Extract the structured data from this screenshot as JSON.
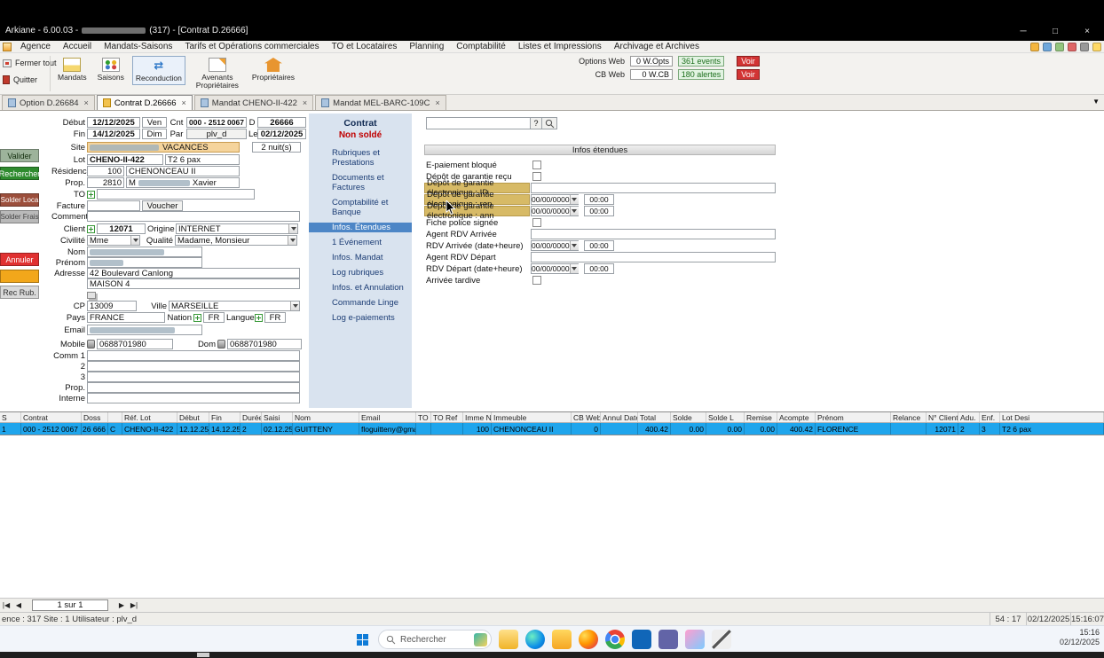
{
  "icons": {
    "minimize": "─",
    "maximize": "□",
    "close": "×",
    "tab_close": "×",
    "chevron_down": "▼",
    "first": "|◀",
    "prev": "◀",
    "next": "▶",
    "last": "▶|",
    "help": "?",
    "swap": "⇄"
  },
  "colors": {
    "selected_row": "#1fa5ec",
    "nav_selected": "#4d86c6",
    "highlight_gold": "#d7ba66",
    "site_highlight": "#f5d49c",
    "annuler_red": "#e03131",
    "rechercher_green": "#2e8b2e",
    "voir_red": "#d23434"
  },
  "window": {
    "title_prefix": "Arkiane - 6.00.03 -",
    "title_suffix": "(317) - [Contrat D.26666]"
  },
  "menu": {
    "items": [
      "Agence",
      "Accueil",
      "Mandats-Saisons",
      "Tarifs et Opérations commerciales",
      "TO et Locataires",
      "Planning",
      "Comptabilité",
      "Listes et Impressions",
      "Archivage et Archives"
    ]
  },
  "toolbar": {
    "fermer_tout": "Fermer tout",
    "quitter": "Quitter",
    "mandats": "Mandats",
    "saisons": "Saisons",
    "reconduction": "Reconduction",
    "avenants": "Avenants Propriétaires",
    "proprietaires": "Propriétaires",
    "options_web_label": "Options Web",
    "options_web_value": "0 W.Opts",
    "events_value": "361 events",
    "cb_web_label": "CB Web",
    "cb_web_value": "0 W.CB",
    "alertes_value": "180 alertes",
    "voir": "Voir"
  },
  "tabs": [
    "Option D.26684",
    "Contrat D.26666",
    "Mandat CHENO-II-422",
    "Mandat MEL-BARC-109C"
  ],
  "actions": {
    "valider": "Valider",
    "rechercher": "Rechercher",
    "solder_loca": "Solder Loca",
    "solder_frais": "Solder Frais",
    "annuler": "Annuler",
    "rec_rub": "Rec Rub."
  },
  "form": {
    "debut_label": "Début",
    "debut": "12/12/2025",
    "debut_day": "Ven",
    "cnt_label": "Cnt",
    "cnt": "000 - 2512 0067",
    "d_label": "D",
    "dossier": "26666",
    "fin_label": "Fin",
    "fin": "14/12/2025",
    "fin_day": "Dim",
    "par_label": "Par",
    "par": "plv_d",
    "le_label": "Le",
    "saisi_le": "02/12/2025",
    "site_label": "Site",
    "site": "VACANCES",
    "nuits": "2 nuit(s)",
    "lot_label": "Lot",
    "lot": "CHENO-II-422",
    "lot_type": "T2 6 pax",
    "residence_label": "Résidence",
    "residence_num": "100",
    "residence_name": "CHENONCEAU II",
    "prop_label": "Prop.",
    "prop_num": "2810",
    "prop_prefix": "M",
    "prop_suffix": "Xavier",
    "to_label": "TO",
    "facture_label": "Facture",
    "voucher_label": "Voucher",
    "comment_label": "Comment",
    "client_label": "Client",
    "client": "12071",
    "origine_label": "Origine",
    "origine": "INTERNET",
    "civilite_label": "Civilité",
    "civilite": "Mme",
    "qualite_label": "Qualité",
    "qualite": "Madame, Monsieur",
    "nom_label": "Nom",
    "prenom_label": "Prénom",
    "adresse_label": "Adresse",
    "adresse1": "42 Boulevard Canlong",
    "adresse2": "MAISON 4",
    "cp_label": "CP",
    "cp": "13009",
    "ville_label": "Ville",
    "ville": "MARSEILLE",
    "pays_label": "Pays",
    "pays": "FRANCE",
    "nation_label": "Nation",
    "nation": "FR",
    "langue_label": "Langue",
    "langue": "FR",
    "email_label": "Email",
    "mobile_label": "Mobile",
    "mobile": "0688701980",
    "dom_label": "Dom",
    "dom": "0688701980",
    "comm1_label": "Comm 1",
    "comm2_label": "2",
    "comm3_label": "3",
    "comm_prop_label": "Prop.",
    "interne_label": "Interne"
  },
  "nav": {
    "title": "Contrat",
    "status": "Non soldé",
    "items": [
      "Rubriques et Prestations",
      "Documents et Factures",
      "Comptabilité et Banque",
      "Infos. Étendues",
      "1 Événement",
      "Infos. Mandat",
      "Log rubriques",
      "Infos. et Annulation",
      "Commande Linge",
      "Log e-paiements"
    ]
  },
  "panel": {
    "header": "Infos étendues",
    "date_placeholder": "00/00/0000",
    "time_placeholder": "00:00",
    "labels": {
      "epaiement": "E-paiement bloqué",
      "dg_recu": "Dépôt de garantie reçu",
      "dg_id": "Dépôt de garantie électronique : ID",
      "dg_rep": "Dépôt de garantie électronique : rep",
      "dg_ann": "Dépôt de garantie électronique : ann",
      "fiche": "Fiche police signée",
      "agent_arrivee": "Agent RDV Arrivée",
      "rdv_arrivee": "RDV Arrivée (date+heure)",
      "agent_depart": "Agent RDV Départ",
      "rdv_depart": "RDV Départ (date+heure)",
      "tardive": "Arrivée tardive"
    }
  },
  "table": {
    "columns": [
      "S",
      "Contrat",
      "Doss",
      "",
      "Réf. Lot",
      "Début",
      "Fin",
      "Durée",
      "Saisi",
      "Nom",
      "Email",
      "TO",
      "TO Ref",
      "Imme N°",
      "Immeuble",
      "CB Web",
      "Annul Date",
      "Total",
      "Solde",
      "Solde L",
      "Remise",
      "Acompte",
      "Prénom",
      "Relance",
      "N° Client",
      "Adu.",
      "Enf.",
      "Lot Desi"
    ],
    "row": [
      "1",
      "000 - 2512 0067",
      "26 666",
      "C",
      "CHENO-II-422",
      "12.12.25",
      "14.12.25",
      "2",
      "02.12.25",
      "GUITTENY",
      "floguitteny@gmail.co",
      "",
      "",
      "100",
      "CHENONCEAU II",
      "0",
      "",
      "400.42",
      "0.00",
      "0.00",
      "0.00",
      "400.42",
      "FLORENCE",
      "",
      "12071",
      "2",
      "3",
      "T2 6 pax"
    ]
  },
  "recnav": {
    "count": "1 sur 1"
  },
  "statusbar": {
    "left": "ence : 317      Site : 1      Utilisateur : plv_d",
    "counter": "54 : 17",
    "date": "02/12/2025",
    "time": "15:16:07"
  },
  "taskbar": {
    "search_placeholder": "Rechercher",
    "time": "15:16",
    "date": "02/12/2025"
  }
}
